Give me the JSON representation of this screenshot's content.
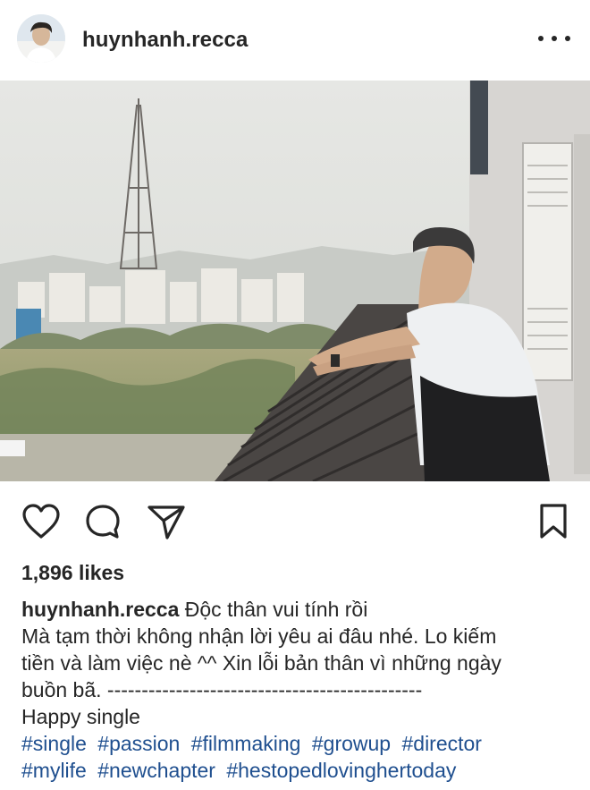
{
  "post": {
    "username": "huynhanh.recca",
    "likes": "1,896 likes",
    "caption": {
      "username": "huynhanh.recca",
      "first": "Độc thân vui tính rồi",
      "lines": [
        "Mà tạm thời không nhận lời yêu ai đâu nhé. Lo kiếm",
        "tiền và làm việc nè ^^ Xin lỗi bản thân vì những ngày",
        "buồn bã. ----------------------------------------------",
        "Happy single"
      ]
    },
    "hashtags_row1": [
      "#single",
      "#passion",
      "#filmmaking",
      "#growup",
      "#director"
    ],
    "hashtags_row2": [
      "#mylife",
      "#newchapter",
      "#hestopedlovinghertoday"
    ]
  },
  "icons": {
    "more": "more-options-icon",
    "like": "heart-icon",
    "comment": "comment-icon",
    "share": "send-icon",
    "save": "bookmark-icon"
  },
  "colors": {
    "text": "#262626",
    "hashtag": "#1f4f8f",
    "background": "#ffffff"
  }
}
